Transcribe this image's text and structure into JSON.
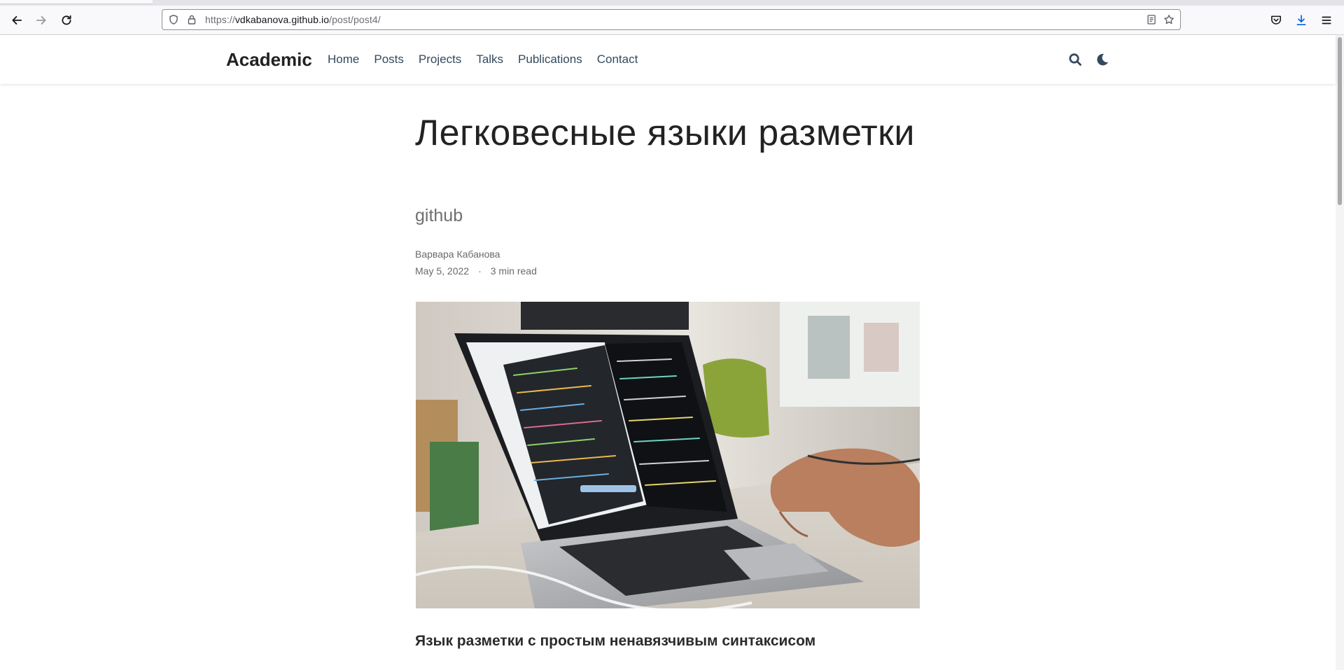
{
  "browser": {
    "url_scheme": "https://",
    "url_host": "vdkabanova.github.io",
    "url_path": "/post/post4/",
    "nav_icons": [
      "back-arrow-icon",
      "forward-arrow-icon",
      "reload-icon"
    ],
    "url_icons": [
      "shield-icon",
      "lock-icon",
      "reader-mode-icon",
      "bookmark-star-icon"
    ],
    "toolbar_icons": [
      "pocket-icon",
      "download-icon",
      "hamburger-menu-icon"
    ],
    "accent_color": "#0060df"
  },
  "site": {
    "brand": "Academic",
    "menu": [
      "Home",
      "Posts",
      "Projects",
      "Talks",
      "Publications",
      "Contact"
    ],
    "header_icons": [
      "search-icon",
      "moon-icon"
    ],
    "text_color": "#34495e"
  },
  "article": {
    "title": "Легковесные языки разметки",
    "subtitle": "github",
    "author": "Варвара Кабанова",
    "date": "May 5, 2022",
    "separator": "·",
    "reading_time": "3 min read",
    "image_description_icon": "laptop-with-code-photo",
    "section_heading": "Язык разметки с простым ненавязчивым синтаксисом"
  }
}
